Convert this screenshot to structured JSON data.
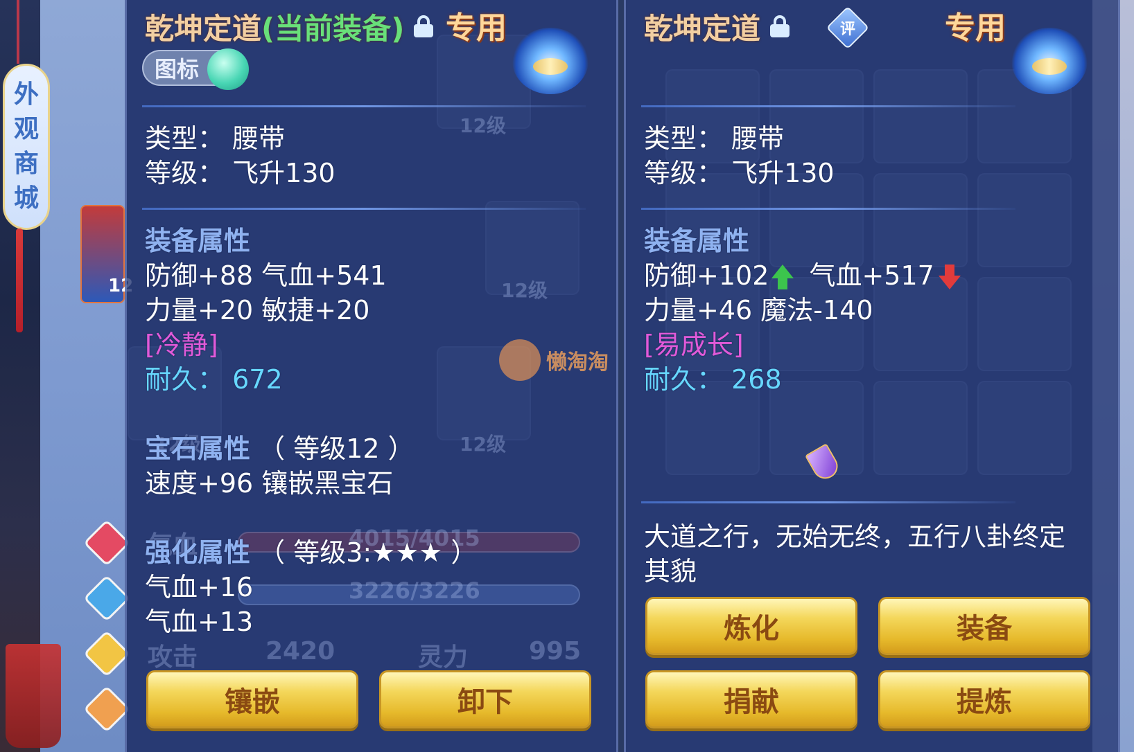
{
  "side": {
    "shop_chars": [
      "外",
      "观",
      "商",
      "城"
    ],
    "avatar_level": "12"
  },
  "background": {
    "grid_labels": [
      "12级",
      "12级",
      "12级",
      "12级"
    ],
    "hp_text": "4015/4015",
    "hp_label": "气血",
    "mp_text": "3226/3226",
    "attack_label": "攻击",
    "attack_value": "2420",
    "spirit_label": "灵力",
    "spirit_value": "995"
  },
  "watermark": {
    "text": "懒淘淘"
  },
  "current_item": {
    "name": "乾坤定道",
    "equipped_tag": "(当前装备)",
    "exclusive_tag": "专用",
    "icon_toggle_label": "图标",
    "type_line": "类型：  腰带",
    "level_line": "等级：  飞升130",
    "attr_section": "装备属性",
    "attr_line1": "防御+88 气血+541",
    "attr_line2": "力量+20 敏捷+20",
    "special": "[冷静]",
    "durability_label": "耐久：",
    "durability_value": "672",
    "gem_section": "宝石属性",
    "gem_level": "（ 等级12 ）",
    "gem_line": "速度+96 镶嵌黑宝石",
    "enhance_section": "强化属性",
    "enhance_level": "（ 等级3:★★★ ）",
    "enhance_line1": "气血+16",
    "enhance_line2": "气血+13",
    "buttons": [
      "镶嵌",
      "卸下"
    ]
  },
  "compare_item": {
    "name": "乾坤定道",
    "rate_label": "评",
    "exclusive_tag": "专用",
    "type_line": "类型：  腰带",
    "level_line": "等级：  飞升130",
    "attr_section": "装备属性",
    "attr_def": "防御+102",
    "attr_hp": "气血+517",
    "attr_line2": "力量+46 魔法-140",
    "special": "[易成长]",
    "durability_label": "耐久：",
    "durability_value": "268",
    "description_line1": "大道之行，无始无终，五行八卦终定",
    "description_line2": "其貌",
    "buttons": [
      "炼化",
      "装备",
      "捐献",
      "提炼"
    ]
  },
  "colors": {
    "title": "#f2cfa2",
    "equipped_green": "#68e07a",
    "section_blue": "#8fb2f0",
    "special_magenta": "#e15ad9",
    "durability_cyan": "#67d8ff",
    "up_arrow": "#3cc44d",
    "down_arrow": "#e23b3b",
    "button_gold": "#f4d75b"
  }
}
